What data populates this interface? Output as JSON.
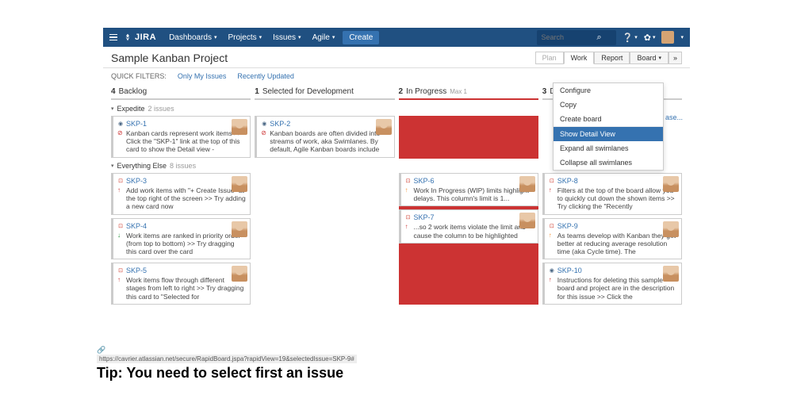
{
  "nav": {
    "logo": "JIRA",
    "items": [
      "Dashboards",
      "Projects",
      "Issues",
      "Agile"
    ],
    "create": "Create",
    "search_placeholder": "Search"
  },
  "project": {
    "title": "Sample Kanban Project",
    "tabs": {
      "plan": "Plan",
      "work": "Work",
      "report": "Report",
      "board": "Board"
    }
  },
  "filters": {
    "label": "QUICK FILTERS:",
    "items": [
      "Only My Issues",
      "Recently Updated"
    ]
  },
  "columns": [
    {
      "count": "4",
      "name": "Backlog"
    },
    {
      "count": "1",
      "name": "Selected for Development"
    },
    {
      "count": "2",
      "name": "In Progress",
      "max": "Max 1",
      "over": true
    },
    {
      "count": "3",
      "name": "Done"
    }
  ],
  "release_link": "ase...",
  "swimlanes": [
    {
      "name": "Expedite",
      "count": "2 issues",
      "cols": [
        [
          {
            "key": "SKP-1",
            "type": "story",
            "pr": "bug",
            "pr_color": "red",
            "summary": "Kanban cards represent work items >> Click the \"SKP-1\" link at the top of this card to show the Detail view -"
          }
        ],
        [
          {
            "key": "SKP-2",
            "type": "story",
            "pr": "bug",
            "pr_color": "red",
            "summary": "Kanban boards are often divided into streams of work, aka Swimlanes. By default, Agile Kanban boards include"
          }
        ],
        [],
        []
      ],
      "col_over": [
        false,
        false,
        true,
        false
      ]
    },
    {
      "name": "Everything Else",
      "count": "8 issues",
      "cols": [
        [
          {
            "key": "SKP-3",
            "type": "bug",
            "pr": "up",
            "pr_color": "red",
            "summary": "Add work items with \"+ Create Issue\" at the top right of the screen >> Try adding a new card now"
          },
          {
            "key": "SKP-4",
            "type": "bug",
            "pr": "down",
            "pr_color": "green",
            "summary": "Work items are ranked in priority order (from top to bottom) >> Try dragging this card over the card"
          },
          {
            "key": "SKP-5",
            "type": "bug",
            "pr": "up",
            "pr_color": "red",
            "summary": "Work items flow through different stages from left to right >> Try dragging this card to \"Selected for"
          }
        ],
        [],
        [
          {
            "key": "SKP-6",
            "type": "bug",
            "pr": "up",
            "pr_color": "orange",
            "summary": "Work In Progress (WIP) limits highlight delays. This column's limit is 1..."
          },
          {
            "key": "SKP-7",
            "type": "bug",
            "pr": "up",
            "pr_color": "red",
            "summary": "...so 2 work items violate the limit and cause the column to be highlighted"
          }
        ],
        [
          {
            "key": "SKP-8",
            "type": "bug",
            "pr": "up",
            "pr_color": "red",
            "summary": "Filters at the top of the board allow you to quickly cut down the shown items >> Try clicking the \"Recently"
          },
          {
            "key": "SKP-9",
            "type": "bug",
            "pr": "up",
            "pr_color": "orange",
            "summary": "As teams develop with Kanban they get better at reducing average resolution time (aka Cycle time). The"
          },
          {
            "key": "SKP-10",
            "type": "story",
            "pr": "up",
            "pr_color": "red",
            "summary": "Instructions for deleting this sample board and project are in the description for this issue >> Click the"
          }
        ]
      ],
      "col_over": [
        false,
        false,
        true,
        false
      ]
    }
  ],
  "board_menu": [
    {
      "label": "Configure"
    },
    {
      "label": "Copy"
    },
    {
      "label": "Create board"
    },
    {
      "label": "Show Detail View",
      "selected": true
    },
    {
      "label": "Expand all swimlanes"
    },
    {
      "label": "Collapse all swimlanes"
    }
  ],
  "tip": {
    "url": "https://cavrier.atlassian.net/secure/RapidBoard.jspa?rapidView=19&selectedIssue=SKP-9#",
    "text": "Tip: You need to select first an issue"
  }
}
